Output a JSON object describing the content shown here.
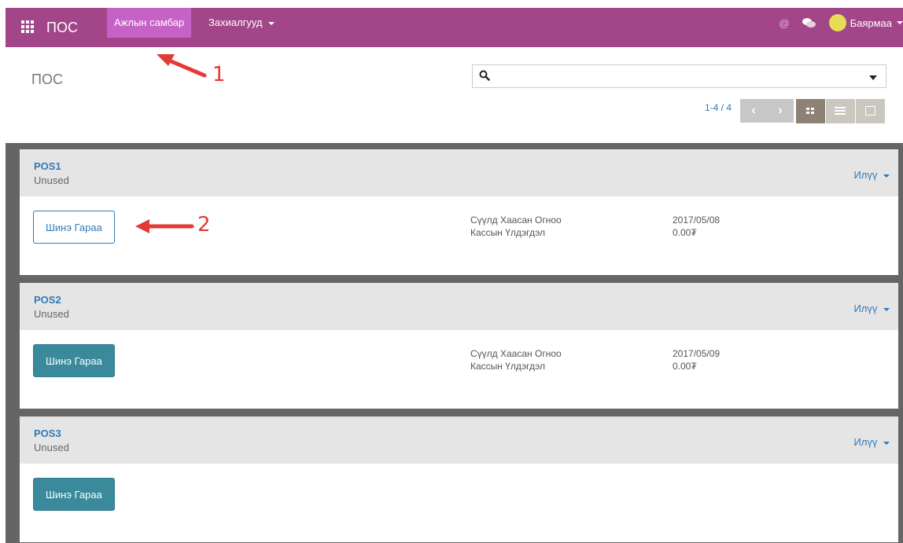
{
  "navbar": {
    "brand": "ПОС",
    "menu": [
      {
        "label": "Ажлын самбар"
      },
      {
        "label": "Захиалгууд"
      }
    ],
    "user": "Баярмаа",
    "at_symbol": "@"
  },
  "header": {
    "title": "ПОС",
    "search": {
      "value": "",
      "placeholder": ""
    },
    "pager": "1-4 / 4",
    "prev": "‹",
    "next": "›"
  },
  "cards": [
    {
      "title": "POS1",
      "status": "Unused",
      "more": "Илүү",
      "button": "Шинэ Гараа",
      "info": [
        {
          "label": "Сүүлд Хаасан Огноо",
          "value": "2017/05/08"
        },
        {
          "label": "Кассын Үлдэгдэл",
          "value": "0.00₮"
        }
      ]
    },
    {
      "title": "POS2",
      "status": "Unused",
      "more": "Илүү",
      "button": "Шинэ Гараа",
      "info": [
        {
          "label": "Сүүлд Хаасан Огноо",
          "value": "2017/05/09"
        },
        {
          "label": "Кассын Үлдэгдэл",
          "value": "0.00₮"
        }
      ]
    },
    {
      "title": "POS3",
      "status": "Unused",
      "more": "Илүү",
      "button": "Шинэ Гараа"
    }
  ],
  "annotations": {
    "one": "1",
    "two": "2"
  },
  "colors": {
    "navbar": "#a24689",
    "active_menu": "#c661c6",
    "link": "#337ab7",
    "button": "#3a8a9b",
    "arrow": "#e53935"
  }
}
